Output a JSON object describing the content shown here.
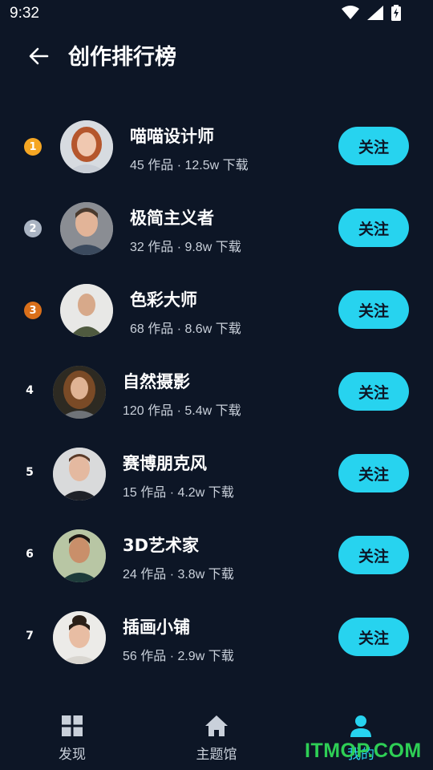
{
  "status_bar": {
    "time": "9:32"
  },
  "header": {
    "title": "创作排行榜"
  },
  "ranking": [
    {
      "rank": "1",
      "name": "喵喵设计师",
      "stats": "45 作品 · 12.5w 下载",
      "follow_label": "关注",
      "badge_color": "#f5a623"
    },
    {
      "rank": "2",
      "name": "极简主义者",
      "stats": "32 作品 · 9.8w 下载",
      "follow_label": "关注",
      "badge_color": "#aab4c3"
    },
    {
      "rank": "3",
      "name": "色彩大师",
      "stats": "68 作品 · 8.6w 下载",
      "follow_label": "关注",
      "badge_color": "#d96f1a"
    },
    {
      "rank": "4",
      "name": "自然摄影",
      "stats": "120 作品 · 5.4w 下载",
      "follow_label": "关注"
    },
    {
      "rank": "5",
      "name": "赛博朋克风",
      "stats": "15 作品 · 4.2w 下载",
      "follow_label": "关注"
    },
    {
      "rank": "6",
      "name": "3D艺术家",
      "stats": "24 作品 · 3.8w 下载",
      "follow_label": "关注"
    },
    {
      "rank": "7",
      "name": "插画小铺",
      "stats": "56 作品 · 2.9w 下载",
      "follow_label": "关注"
    }
  ],
  "bottom_nav": {
    "items": [
      {
        "label": "发现",
        "icon": "grid-icon"
      },
      {
        "label": "主题馆",
        "icon": "home-icon"
      },
      {
        "label": "我的",
        "icon": "person-icon",
        "active": true
      }
    ]
  },
  "watermark": "ITMOP.COM",
  "colors": {
    "background": "#0d1626",
    "accent": "#27d3ef"
  }
}
